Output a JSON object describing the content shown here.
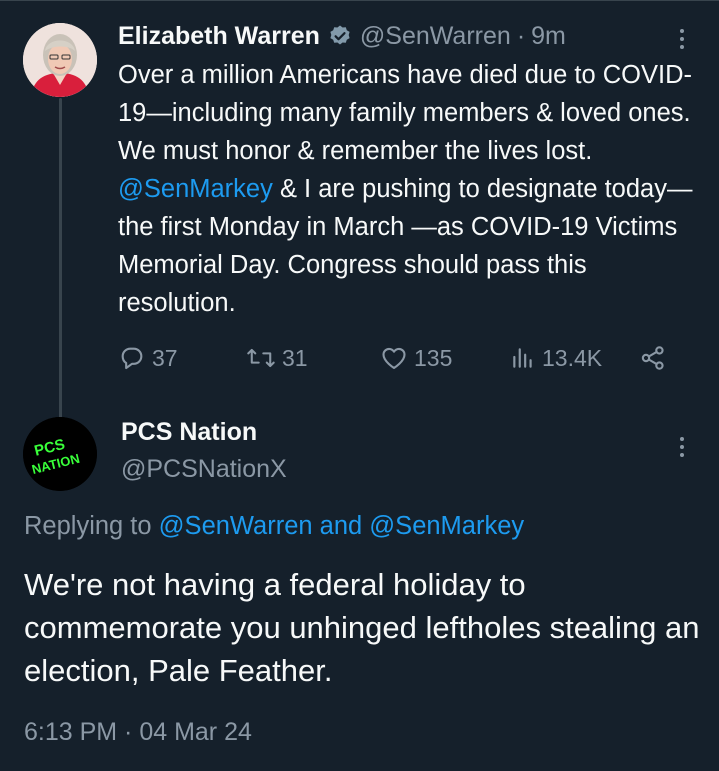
{
  "tweet1": {
    "author_name": "Elizabeth Warren",
    "handle": "@SenWarren",
    "separator": "·",
    "time_ago": "9m",
    "text_part1": "Over a million Americans have died due to COVID-19—including many family members & loved ones. We must honor & remember the lives lost. ",
    "mention": "@SenMarkey",
    "text_part2": " & I are pushing to designate today—the first Monday in March —as COVID-19 Victims Memorial Day. Congress should pass this resolution.",
    "replies": "37",
    "retweets": "31",
    "likes": "135",
    "views": "13.4K"
  },
  "tweet2": {
    "author_name": "PCS Nation",
    "handle": "@PCSNationX",
    "avatar_text_line1": "PCS",
    "avatar_text_line2": "NATION",
    "replying_prefix": "Replying to ",
    "replying_mentions": "@SenWarren and @SenMarkey",
    "text": "We're not having a federal holiday to commemorate you unhinged leftholes stealing an election, Pale Feather.",
    "timestamp": "6:13 PM · 04 Mar 24"
  },
  "colors": {
    "background": "#15202b",
    "text_primary": "#f7f9f9",
    "text_secondary": "#8b98a5",
    "link": "#1d9bf0",
    "divider": "#38444d",
    "pcs_avatar_text": "#39ff3a"
  },
  "icons": [
    "verified-badge-icon",
    "more-icon",
    "reply-icon",
    "retweet-icon",
    "like-icon",
    "views-icon",
    "share-icon"
  ]
}
